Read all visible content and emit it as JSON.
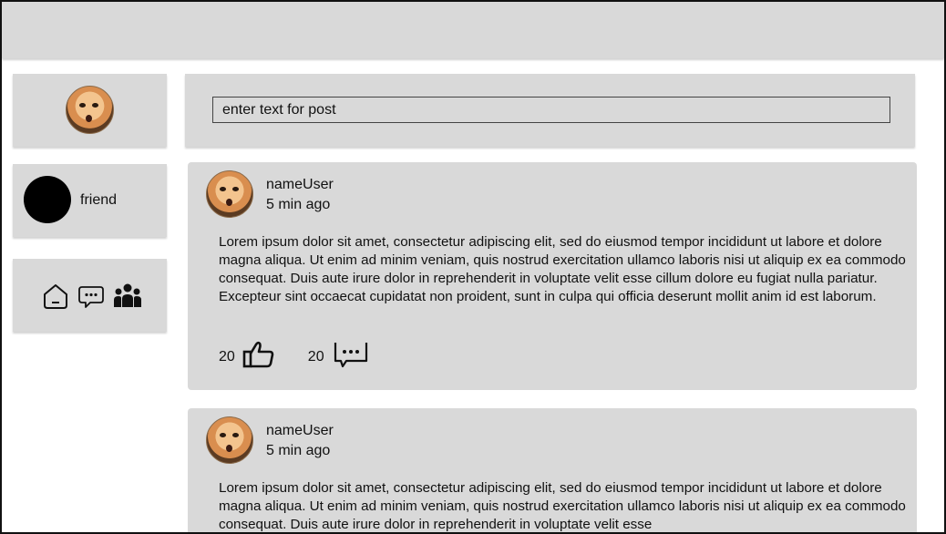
{
  "composer": {
    "placeholder": "enter text for post"
  },
  "friends": [
    {
      "name": "friend"
    }
  ],
  "nav": {
    "icons": [
      "home-icon",
      "chat-icon",
      "group-icon"
    ]
  },
  "posts": [
    {
      "user": "nameUser",
      "time": "5 min ago",
      "body": "Lorem ipsum dolor sit amet, consectetur adipiscing elit, sed do eiusmod tempor incididunt ut labore et dolore magna aliqua. Ut enim ad minim veniam, quis nostrud exercitation ullamco laboris nisi ut aliquip ex ea commodo consequat. Duis aute irure dolor in reprehenderit in voluptate velit esse cillum dolore eu fugiat nulla pariatur. Excepteur sint occaecat cupidatat non proident, sunt in culpa qui officia deserunt mollit anim id est laborum.",
      "likes": "20",
      "comments": "20"
    },
    {
      "user": "nameUser",
      "time": "5 min ago",
      "body": "Lorem ipsum dolor sit amet, consectetur adipiscing elit, sed do eiusmod tempor incididunt ut labore et dolore magna aliqua. Ut enim ad minim veniam, quis nostrud exercitation ullamco laboris nisi ut aliquip ex ea commodo consequat. Duis aute irure dolor in reprehenderit in voluptate velit esse"
    }
  ],
  "colors": {
    "panel": "#d9d9d9",
    "border": "#111111"
  }
}
